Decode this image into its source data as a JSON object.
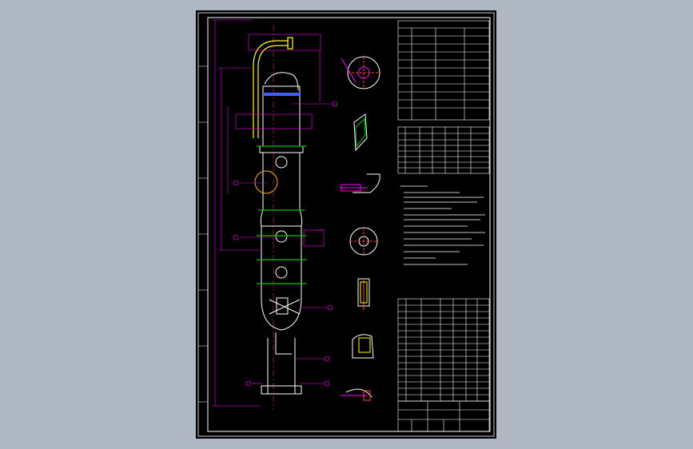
{
  "app": {
    "viewport_background": "#aeb7c2",
    "sheet_background": "#000000"
  },
  "colors": {
    "frame": "#ffffff",
    "vessel": "#ffffff",
    "dimension": "#ff00ff",
    "callout": "#ff00ff",
    "centerline": "#ff4040",
    "insulation": "#00c800",
    "packing": "#3f5fff",
    "pipe": "#ffff00",
    "table_line": "#ffffff"
  },
  "icons": {
    "flange_section": "flange-section-icon",
    "manway_section": "manway-section-icon",
    "nozzle_detail": "nozzle-detail-icon",
    "support_ring": "support-ring-icon"
  }
}
